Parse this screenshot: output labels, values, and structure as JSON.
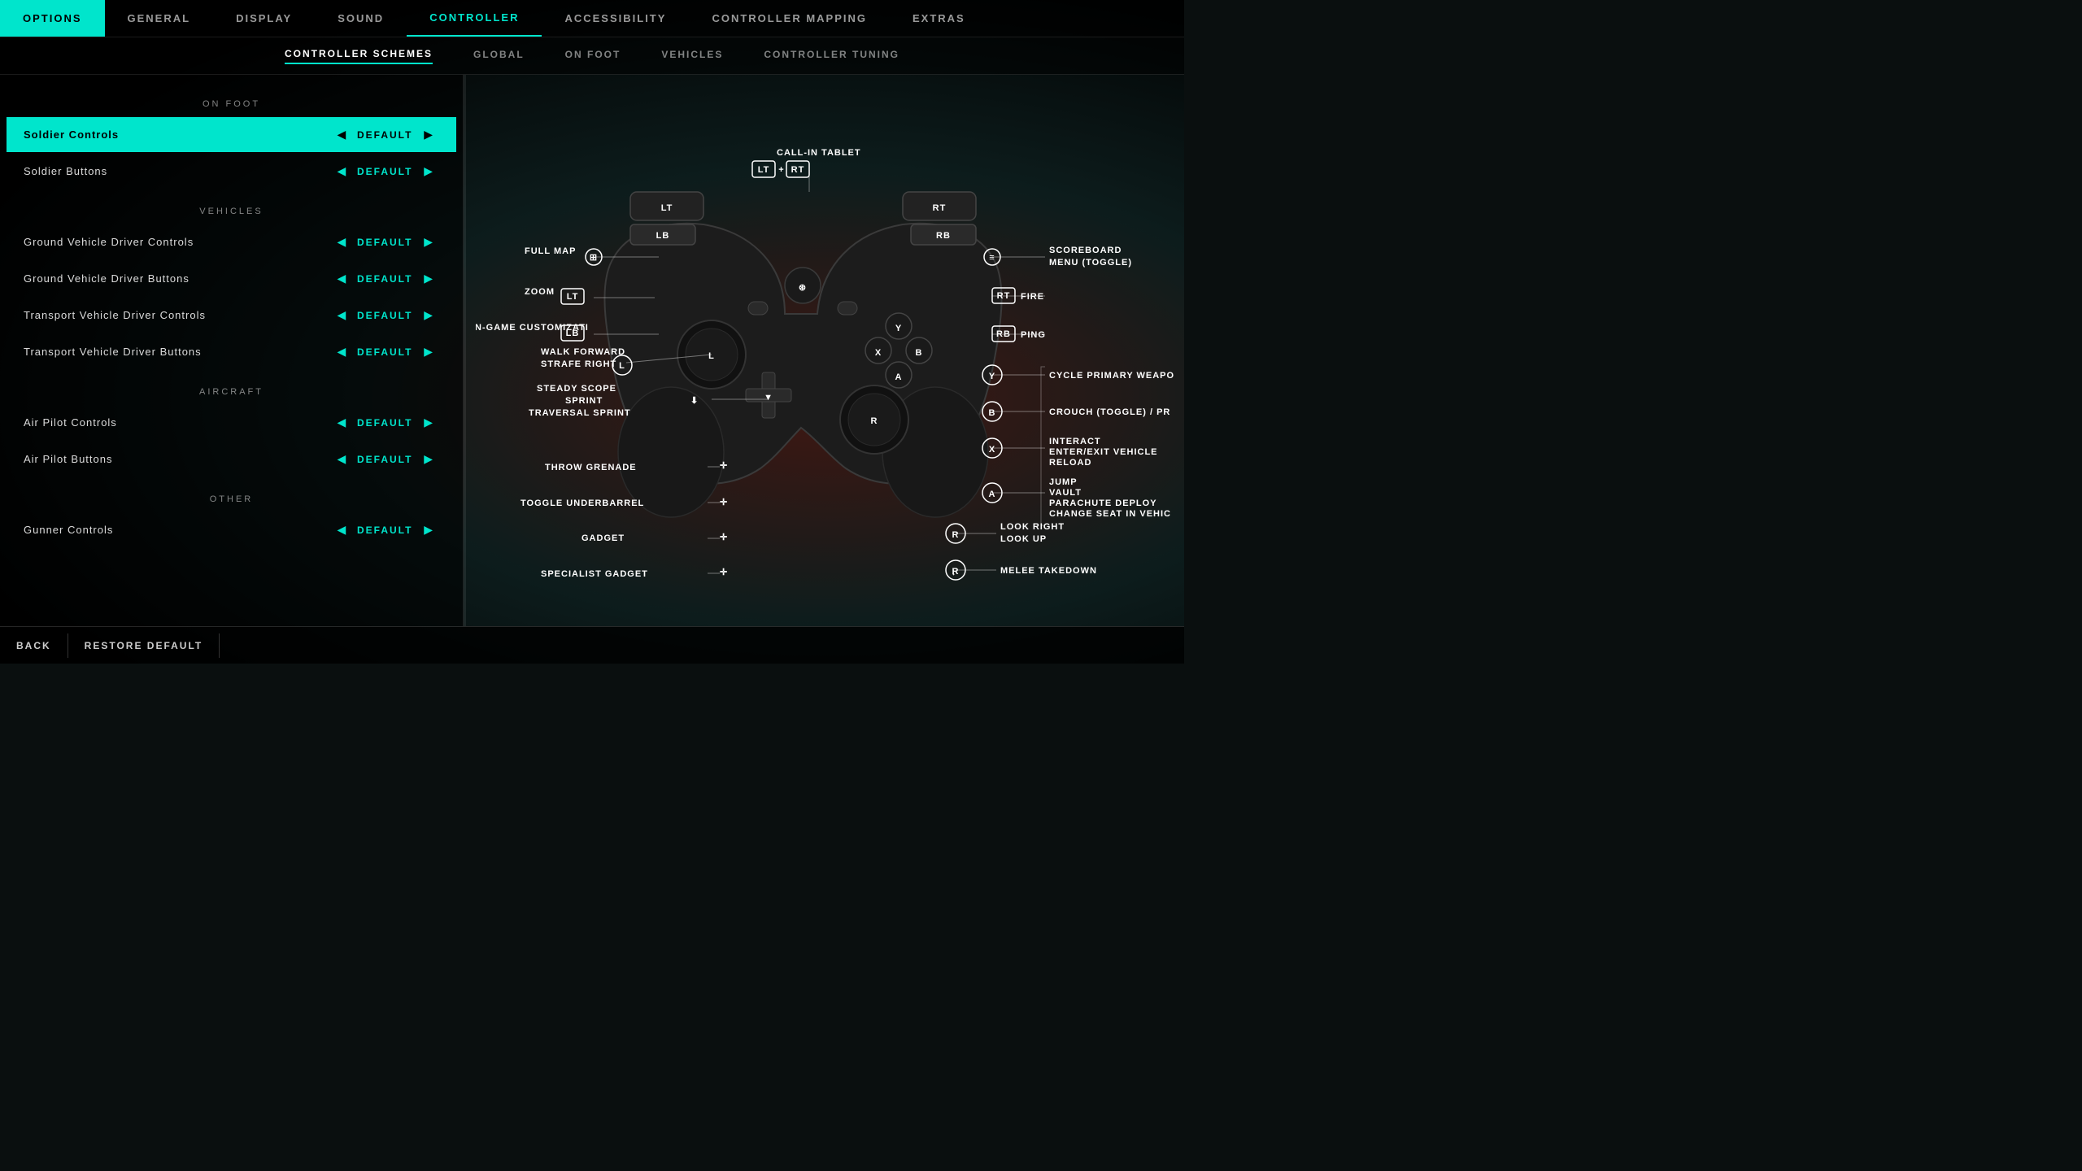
{
  "topNav": {
    "items": [
      {
        "id": "options",
        "label": "OPTIONS",
        "active": true
      },
      {
        "id": "general",
        "label": "GENERAL",
        "active": false
      },
      {
        "id": "display",
        "label": "DISPLAY",
        "active": false
      },
      {
        "id": "sound",
        "label": "SOUND",
        "active": false
      },
      {
        "id": "controller",
        "label": "CONTROLLER",
        "active": true
      },
      {
        "id": "accessibility",
        "label": "ACCESSIBILITY",
        "active": false
      },
      {
        "id": "controller-mapping",
        "label": "CONTROLLER MAPPING",
        "active": false
      },
      {
        "id": "extras",
        "label": "EXTRAS",
        "active": false
      }
    ]
  },
  "subNav": {
    "items": [
      {
        "id": "schemes",
        "label": "CONTROLLER SCHEMES",
        "active": true
      },
      {
        "id": "global",
        "label": "GLOBAL",
        "active": false
      },
      {
        "id": "on-foot",
        "label": "ON FOOT",
        "active": false
      },
      {
        "id": "vehicles",
        "label": "VEHICLES",
        "active": false
      },
      {
        "id": "tuning",
        "label": "CONTROLLER TUNING",
        "active": false
      }
    ]
  },
  "leftPanel": {
    "sections": [
      {
        "id": "on-foot",
        "header": "ON FOOT",
        "rows": [
          {
            "id": "soldier-controls",
            "name": "Soldier Controls",
            "value": "DEFAULT",
            "highlighted": true
          },
          {
            "id": "soldier-buttons",
            "name": "Soldier Buttons",
            "value": "DEFAULT",
            "highlighted": false
          }
        ]
      },
      {
        "id": "vehicles",
        "header": "VEHICLES",
        "rows": [
          {
            "id": "gvd-controls",
            "name": "Ground Vehicle Driver Controls",
            "value": "DEFAULT",
            "highlighted": false
          },
          {
            "id": "gvd-buttons",
            "name": "Ground Vehicle Driver Buttons",
            "value": "DEFAULT",
            "highlighted": false
          },
          {
            "id": "tvd-controls",
            "name": "Transport Vehicle Driver Controls",
            "value": "DEFAULT",
            "highlighted": false
          },
          {
            "id": "tvd-buttons",
            "name": "Transport Vehicle Driver Buttons",
            "value": "DEFAULT",
            "highlighted": false
          }
        ]
      },
      {
        "id": "aircraft",
        "header": "AIRCRAFT",
        "rows": [
          {
            "id": "air-pilot-controls",
            "name": "Air Pilot Controls",
            "value": "DEFAULT",
            "highlighted": false
          },
          {
            "id": "air-pilot-buttons",
            "name": "Air Pilot Buttons",
            "value": "DEFAULT",
            "highlighted": false
          }
        ]
      },
      {
        "id": "other",
        "header": "OTHER",
        "rows": [
          {
            "id": "gunner-controls",
            "name": "Gunner Controls",
            "value": "DEFAULT",
            "highlighted": false
          }
        ]
      }
    ]
  },
  "diagram": {
    "labels": {
      "callInTablet": "CALL-IN TABLET",
      "lt": "LT",
      "rt": "RT",
      "plus": "+",
      "fullMap": "FULL MAP",
      "zoom": "ZOOM",
      "inGameCustomization": "IN-GAME CUSTOMIZATI",
      "lb": "LB",
      "rb": "RB",
      "scoreboard": "SCOREBOARD",
      "scoreboardSub": "MENU (TOGGLE)",
      "fire": "FIRE",
      "ping": "PING",
      "walkForward": "WALK FORWARD",
      "strafeRight": "STRAFE RIGHT",
      "l": "L",
      "steadyScope": "STEADY SCOPE",
      "sprint": "SPRINT",
      "traversalSprint": "TRAVERSAL SPRINT",
      "throwGrenade": "THROW GRENADE",
      "toggleUnderbarrel": "TOGGLE UNDERBARREL",
      "gadget": "GADGET",
      "specialistGadget": "SPECIALIST GADGET",
      "cyclePrimary": "CYCLE PRIMARY WEAPO",
      "y": "Y",
      "crouchToggle": "CROUCH (TOGGLE) / PR",
      "b": "B",
      "interact": "INTERACT",
      "enterExitVehicle": "ENTER/EXIT VEHICLE",
      "reload": "RELOAD",
      "x": "X",
      "jump": "JUMP",
      "vault": "VAULT",
      "parachuteDeploy": "PARACHUTE DEPLOY",
      "changeSeat": "CHANGE SEAT IN VEHIC",
      "a": "A",
      "lookRight": "LOOK RIGHT",
      "lookUp": "LOOK UP",
      "rStick": "R",
      "meleeTakedown": "MELEE TAKEDOWN",
      "rStick2": "R"
    }
  },
  "bottomBar": {
    "back": "BACK",
    "restoreDefault": "RESTORE DEFAULT"
  }
}
